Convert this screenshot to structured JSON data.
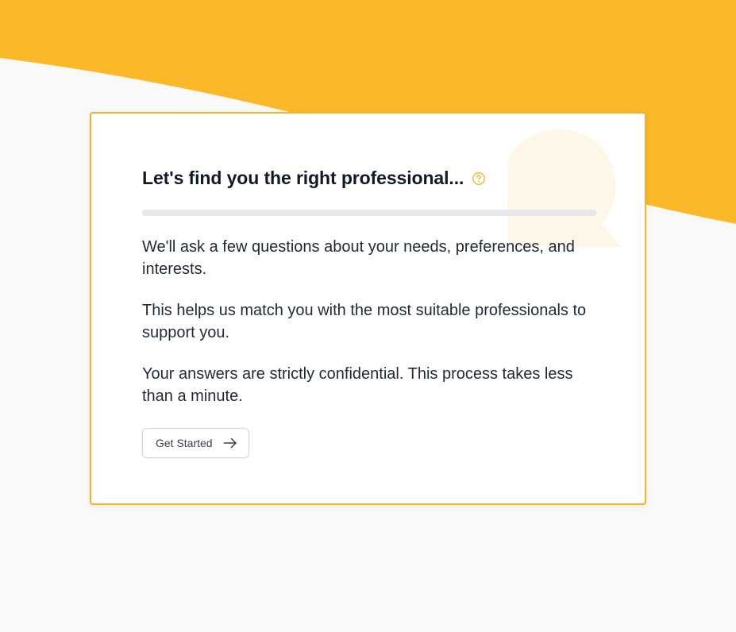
{
  "colors": {
    "accent": "#fbb829",
    "card_border": "#f0b429",
    "background": "#f9f9f9",
    "bubble": "#fef6e7",
    "title": "#111827",
    "body_text": "#1f2937"
  },
  "header": {
    "title": "Let's find you the right professional...",
    "help_icon": "question-circle-icon"
  },
  "progress": {
    "value": 0
  },
  "intro": {
    "paragraph_1": "We'll ask a few questions about your needs, preferences, and interests.",
    "paragraph_2": "This helps us match you with the most suitable professionals to support you.",
    "paragraph_3": "Your answers are strictly confidential. This process takes less than a minute."
  },
  "cta": {
    "label": "Get Started",
    "icon": "arrow-right-icon"
  }
}
